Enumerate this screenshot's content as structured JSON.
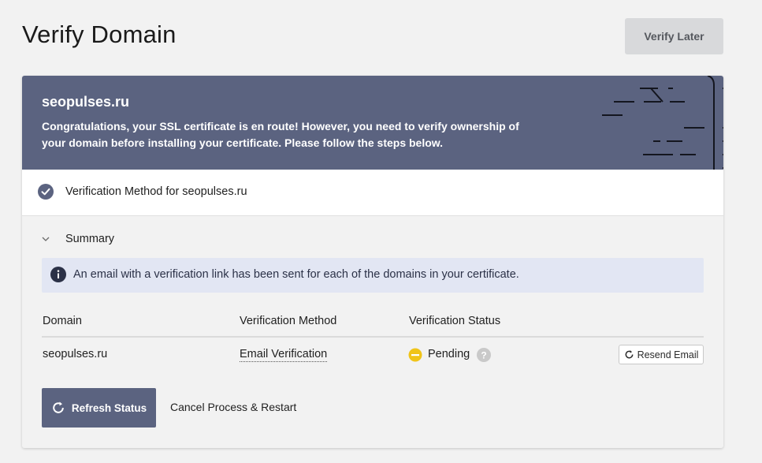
{
  "header": {
    "title": "Verify Domain",
    "verify_later_label": "Verify Later"
  },
  "banner": {
    "domain": "seopulses.ru",
    "message": "Congratulations, your SSL certificate is en route! However, you need to verify ownership of your domain before installing your certificate. Please follow the steps below."
  },
  "method_section": {
    "label": "Verification Method for seopulses.ru",
    "icon": "check-circle-icon"
  },
  "summary": {
    "label": "Summary",
    "info_text": "An email with a verification link has been sent for each of the domains in your certificate.",
    "info_icon": "info-icon"
  },
  "table": {
    "headers": [
      "Domain",
      "Verification Method",
      "Verification Status"
    ],
    "rows": [
      {
        "domain": "seopulses.ru",
        "method": "Email Verification",
        "status": "Pending",
        "status_color": "#f0c419",
        "action_label": "Resend Email"
      }
    ]
  },
  "actions": {
    "refresh_label": "Refresh Status",
    "cancel_label": "Cancel Process & Restart"
  },
  "colors": {
    "brand": "#5b6380",
    "info_background": "#e2e6f3",
    "pending": "#f0c419"
  }
}
